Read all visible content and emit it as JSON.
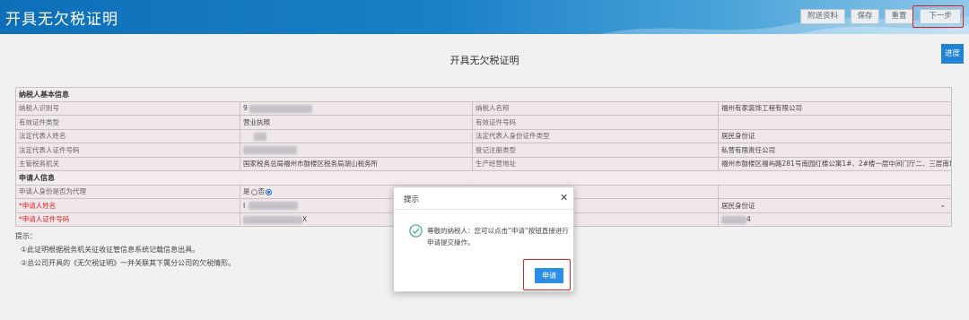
{
  "header": {
    "title": "开具无欠税证明",
    "buttons": {
      "attach": "附送资料",
      "save": "保存",
      "reset": "重置",
      "next": "下一步"
    }
  },
  "progress_label": "进度",
  "page_heading": "开具无欠税证明",
  "taxpayer_section": {
    "title": "纳税人基本信息",
    "rows": [
      [
        "纳税人识别号",
        "9",
        "纳税人名称",
        "福州有家装饰工程有限公司"
      ],
      [
        "有效证件类型",
        "营业执照",
        "有效证件号码",
        ""
      ],
      [
        "法定代表人姓名",
        "",
        "法定代表人身份证件类型",
        "居民身份证"
      ],
      [
        "法定代表人证件号码",
        "",
        "登记注册类型",
        "私营有限责任公司"
      ],
      [
        "主管税务机关",
        "国家税务总局福州市鼓楼区税务局湖山税务所",
        "生产经营地址",
        "福州市鼓楼区福屿路281号南园红楼公寓1#、2#楼一层中间门厅二、三层南场"
      ]
    ]
  },
  "applicant_section": {
    "title": "申请人信息",
    "agent_label": "申请人身份是否为代理",
    "radio_yes": "是",
    "radio_no": "否",
    "name_label": "*申请人姓名",
    "name_value": "I",
    "id_label": "*申请人证件号码",
    "id_value": "X",
    "id_type_value": "居民身份证",
    "id_tail_value": "4"
  },
  "tips": {
    "title": "提示：",
    "lines": [
      "①此证明根据税务机关征收征管信息系统记载信息出具。",
      "②总公司开具的《无欠税证明》一并关联其下属分公司的欠税情形。"
    ]
  },
  "dialog": {
    "title": "提示",
    "close_icon": "close-icon",
    "check_icon": "check-circle-icon",
    "message": "尊敬的纳税人：您可以点击“申请”按钮直接进行申请提交操作。",
    "apply_label": "申请"
  },
  "colors": {
    "header_blue": "#1a7fc7",
    "accent_blue": "#2183d8",
    "highlight_red": "#e02020",
    "row_bg": "#efe7e9",
    "success_green": "#3cb371"
  }
}
